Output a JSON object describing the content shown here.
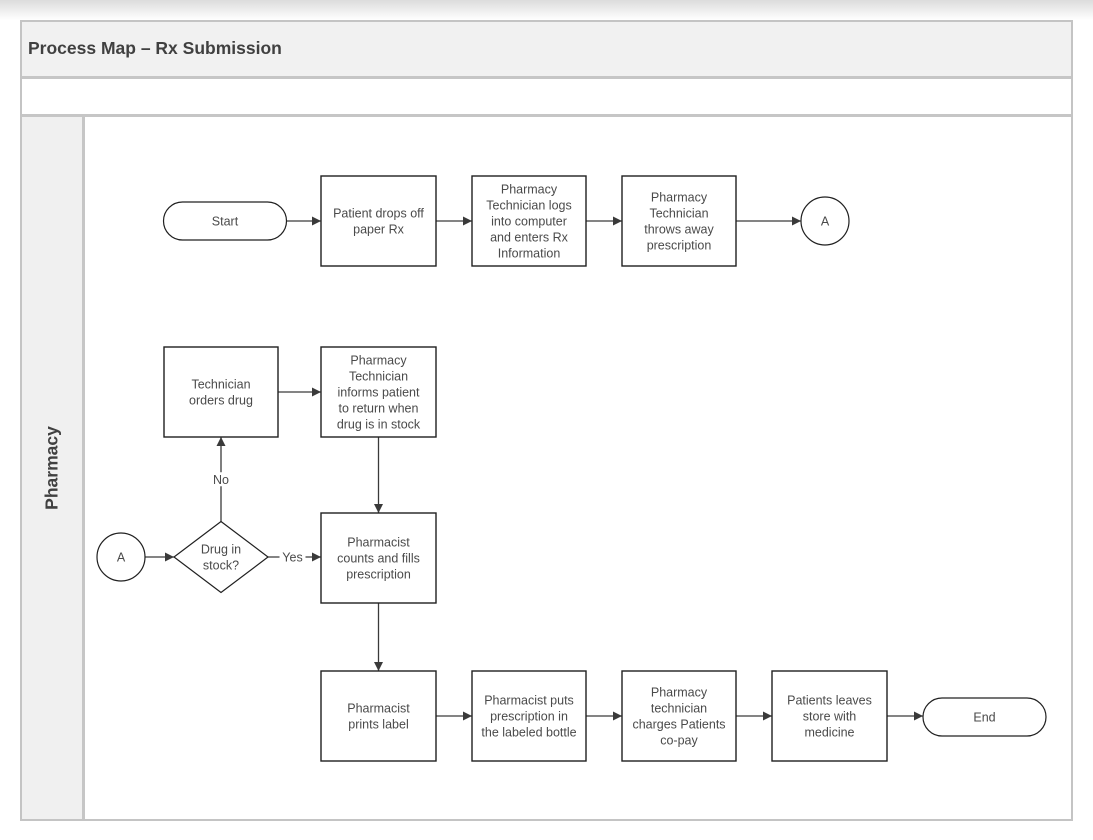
{
  "title": "Process Map – Rx Submission",
  "lane": {
    "label": "Pharmacy"
  },
  "nodes": [
    {
      "id": "start",
      "type": "terminator",
      "lines": [
        "Start"
      ]
    },
    {
      "id": "drop",
      "type": "process",
      "lines": [
        "Patient drops off",
        "paper Rx"
      ]
    },
    {
      "id": "logs",
      "type": "process",
      "lines": [
        "Pharmacy",
        "Technician logs",
        "into computer",
        "and enters Rx",
        "Information"
      ]
    },
    {
      "id": "throws",
      "type": "process",
      "lines": [
        "Pharmacy",
        "Technician",
        "throws away",
        "prescription"
      ]
    },
    {
      "id": "conn-a-out",
      "type": "connector",
      "lines": [
        "A"
      ]
    },
    {
      "id": "conn-a-in",
      "type": "connector",
      "lines": [
        "A"
      ]
    },
    {
      "id": "decision",
      "type": "decision",
      "lines": [
        "Drug in",
        "stock?"
      ]
    },
    {
      "id": "orders",
      "type": "process",
      "lines": [
        "Technician",
        "orders drug"
      ]
    },
    {
      "id": "informs",
      "type": "process",
      "lines": [
        "Pharmacy",
        "Technician",
        "informs patient",
        "to return when",
        "drug is in stock"
      ]
    },
    {
      "id": "counts",
      "type": "process",
      "lines": [
        "Pharmacist",
        "counts and fills",
        "prescription"
      ]
    },
    {
      "id": "prints",
      "type": "process",
      "lines": [
        "Pharmacist",
        "prints label"
      ]
    },
    {
      "id": "puts",
      "type": "process",
      "lines": [
        "Pharmacist puts",
        "prescription in",
        "the labeled bottle"
      ]
    },
    {
      "id": "charges",
      "type": "process",
      "lines": [
        "Pharmacy",
        "technician",
        "charges Patients",
        "co-pay"
      ]
    },
    {
      "id": "leaves",
      "type": "process",
      "lines": [
        "Patients leaves",
        "store with",
        "medicine"
      ]
    },
    {
      "id": "end",
      "type": "terminator",
      "lines": [
        "End"
      ]
    }
  ],
  "edges": [
    {
      "from": "start",
      "to": "drop",
      "label": ""
    },
    {
      "from": "drop",
      "to": "logs",
      "label": ""
    },
    {
      "from": "logs",
      "to": "throws",
      "label": ""
    },
    {
      "from": "throws",
      "to": "conn-a-out",
      "label": ""
    },
    {
      "from": "conn-a-in",
      "to": "decision",
      "label": ""
    },
    {
      "from": "decision",
      "to": "orders",
      "label": "No"
    },
    {
      "from": "decision",
      "to": "counts",
      "label": "Yes"
    },
    {
      "from": "orders",
      "to": "informs",
      "label": ""
    },
    {
      "from": "informs",
      "to": "counts",
      "label": ""
    },
    {
      "from": "counts",
      "to": "prints",
      "label": ""
    },
    {
      "from": "prints",
      "to": "puts",
      "label": ""
    },
    {
      "from": "puts",
      "to": "charges",
      "label": ""
    },
    {
      "from": "charges",
      "to": "leaves",
      "label": ""
    },
    {
      "from": "leaves",
      "to": "end",
      "label": ""
    }
  ],
  "colors": {
    "stroke": "#202020",
    "text": "#4a4a4a",
    "header_bg": "#f1f1f1",
    "border": "#c6c6c6"
  }
}
